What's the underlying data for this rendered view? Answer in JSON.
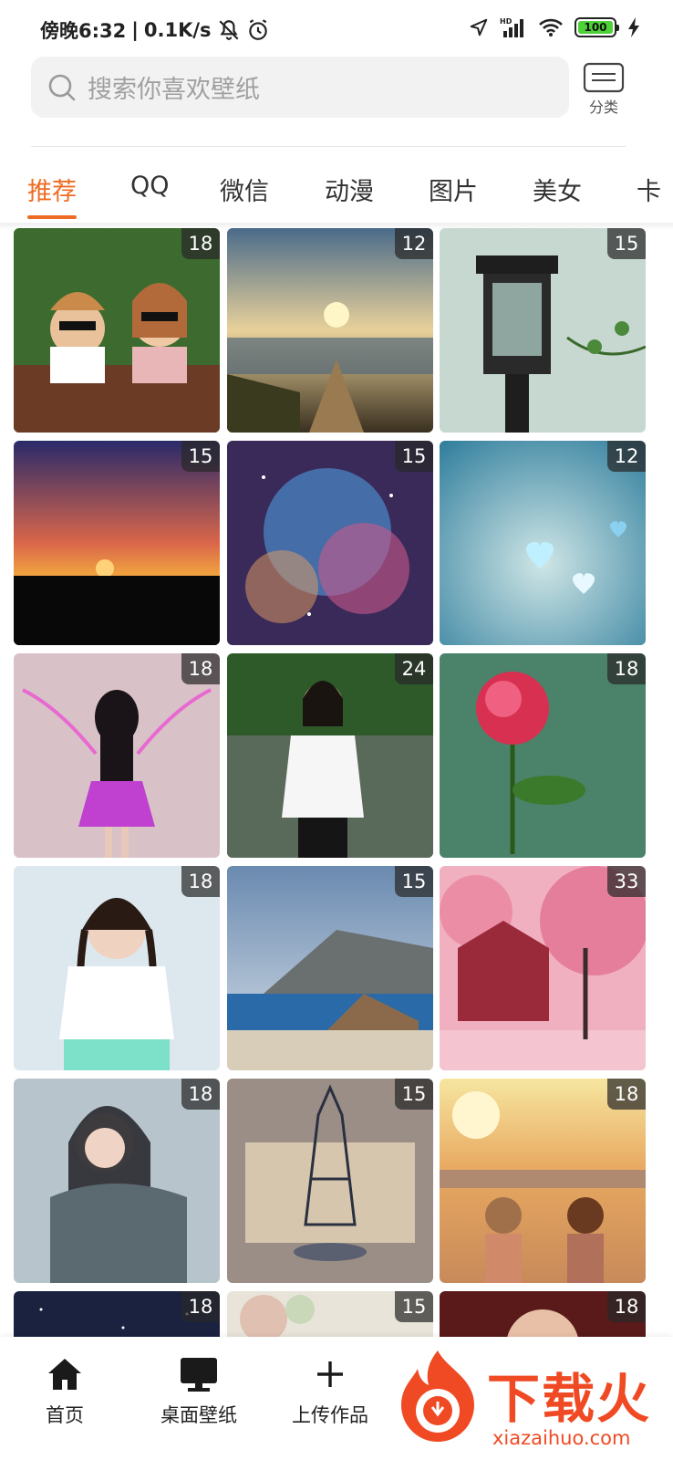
{
  "status_bar": {
    "time": "傍晚6:32",
    "network_speed": "0.1K/s",
    "battery": "100",
    "icons": [
      "mute-icon",
      "alarm-icon",
      "location-icon",
      "hd-signal-icon",
      "wifi-icon",
      "battery-icon",
      "charging-icon"
    ]
  },
  "search": {
    "placeholder": "搜索你喜欢壁纸"
  },
  "category": {
    "label": "分类"
  },
  "tabs": [
    "推荐",
    "QQ",
    "微信",
    "动漫",
    "图片",
    "美女",
    "卡"
  ],
  "accent_color": "#ef6b22",
  "wallpapers": [
    {
      "count": "18"
    },
    {
      "count": "12"
    },
    {
      "count": "15"
    },
    {
      "count": "15"
    },
    {
      "count": "15"
    },
    {
      "count": "12"
    },
    {
      "count": "18"
    },
    {
      "count": "24"
    },
    {
      "count": "18"
    },
    {
      "count": "18"
    },
    {
      "count": "15"
    },
    {
      "count": "33"
    },
    {
      "count": "18"
    },
    {
      "count": "15"
    },
    {
      "count": "18"
    },
    {
      "count": "18"
    },
    {
      "count": "15"
    },
    {
      "count": "18"
    }
  ],
  "bottom_nav": [
    {
      "label": "首页",
      "icon": "home-icon"
    },
    {
      "label": "桌面壁纸",
      "icon": "monitor-icon"
    },
    {
      "label": "上传作品",
      "icon": "plus-icon"
    }
  ],
  "watermark": {
    "text": "下载火",
    "sub": "xiazaihuo.com"
  }
}
